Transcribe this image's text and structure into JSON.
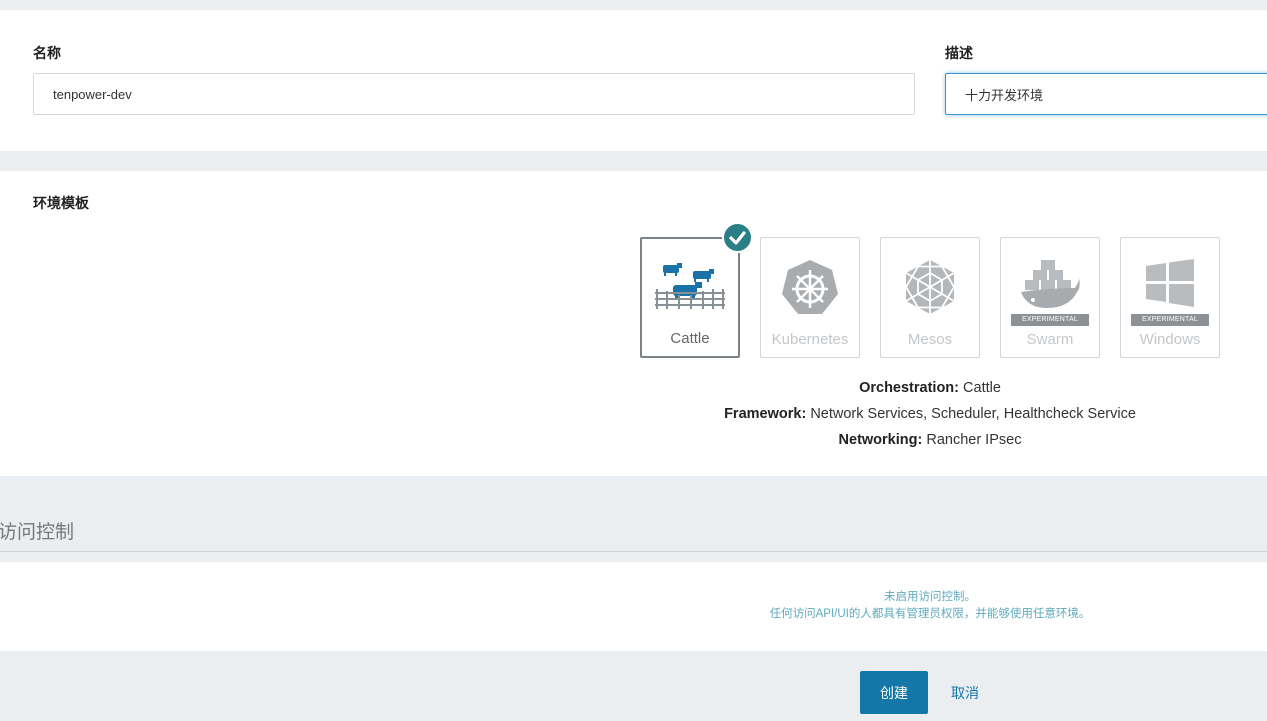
{
  "form": {
    "name_label": "名称",
    "name_value": "tenpower-dev",
    "description_label": "描述",
    "description_value": "十力开发环境"
  },
  "environment": {
    "section_title": "环境模板",
    "templates": [
      {
        "label": "Cattle",
        "icon": "cattle-icon",
        "selected": true,
        "badge": ""
      },
      {
        "label": "Kubernetes",
        "icon": "kubernetes-icon",
        "selected": false,
        "badge": ""
      },
      {
        "label": "Mesos",
        "icon": "mesos-icon",
        "selected": false,
        "badge": ""
      },
      {
        "label": "Swarm",
        "icon": "swarm-icon",
        "selected": false,
        "badge": "EXPERIMENTAL"
      },
      {
        "label": "Windows",
        "icon": "windows-icon",
        "selected": false,
        "badge": "EXPERIMENTAL"
      }
    ],
    "details": {
      "orchestration_label": "Orchestration:",
      "orchestration_value": "Cattle",
      "framework_label": "Framework:",
      "framework_value": "Network Services, Scheduler, Healthcheck Service",
      "networking_label": "Networking:",
      "networking_value": "Rancher IPsec"
    }
  },
  "access_control": {
    "section_title": "访问控制",
    "notice_line1": "未启用访问控制。",
    "notice_line2": "任何访问API/UI的人都具有管理员权限，并能够使用任意环境。"
  },
  "actions": {
    "create_label": "创建",
    "cancel_label": "取消"
  },
  "colors": {
    "accent": "#1377a8",
    "selected_check": "#2a7f86",
    "cattle_blue": "#1a73a8",
    "notice_text": "#5fa9bd"
  }
}
